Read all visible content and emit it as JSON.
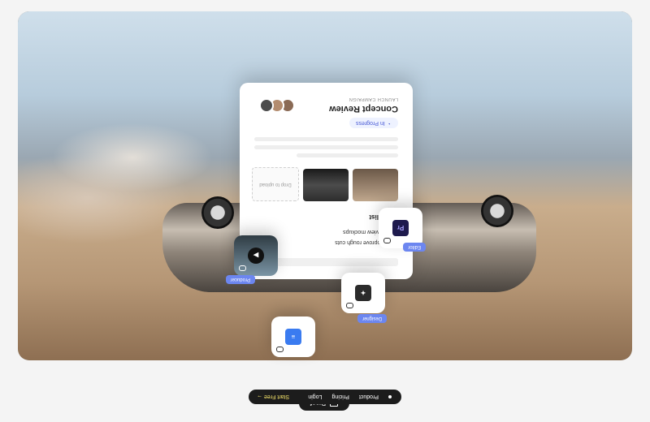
{
  "header": {
    "proof_label": "Proof"
  },
  "nav": {
    "items": [
      "Product",
      "Pricing",
      "Login"
    ],
    "cta": "Start Free",
    "cta_arrow": "→"
  },
  "card": {
    "campaign_label": "LAUNCH CAMPAIGN",
    "title": "Concept Review",
    "status": "In Progress",
    "checklist_title": "Checklist",
    "checklist_items": [
      "Review mockups",
      "Approve rough cuts"
    ],
    "placeholder_text": "Drop to upload"
  },
  "roles": {
    "editor": "Editor",
    "designer": "Designer",
    "producer": "Producer"
  },
  "apps": {
    "premiere_label": "Pr"
  },
  "colors": {
    "accent": "#6c86f0",
    "cta": "#f4e36a",
    "dark": "#1c1c1c"
  }
}
